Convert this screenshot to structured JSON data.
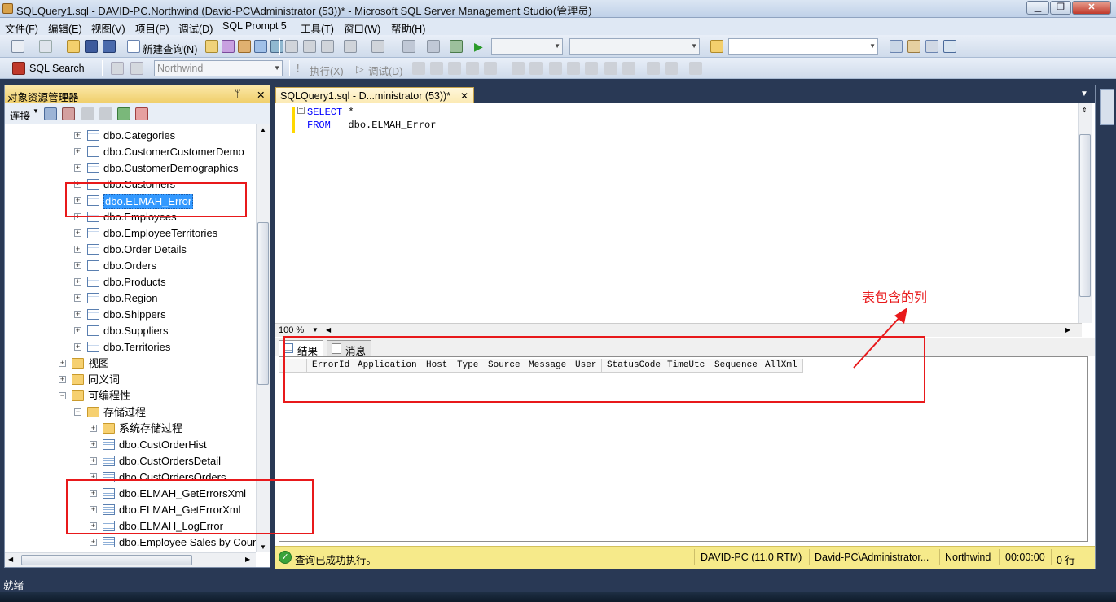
{
  "window": {
    "title": "SQLQuery1.sql - DAVID-PC.Northwind (David-PC\\Administrator (53))* - Microsoft SQL Server Management Studio(管理员)",
    "buttons": [
      "▁",
      "❐",
      "✕"
    ]
  },
  "menu": [
    "文件(F)",
    "编辑(E)",
    "视图(V)",
    "项目(P)",
    "调试(D)",
    "SQL Prompt 5",
    "工具(T)",
    "窗口(W)",
    "帮助(H)"
  ],
  "toolbar1": {
    "new_query": "新建查询(N)"
  },
  "toolbar2": {
    "sql_search": "SQL Search",
    "database": "Northwind",
    "execute": "执行(X)",
    "debug": "调试(D)"
  },
  "object_explorer": {
    "title": "对象资源管理器",
    "connect": "连接",
    "pin": "ᛘ",
    "close": "✕",
    "tree": [
      {
        "label": "dbo.Categories",
        "icon": "table-icon"
      },
      {
        "label": "dbo.CustomerCustomerDemo",
        "icon": "table-icon"
      },
      {
        "label": "dbo.CustomerDemographics",
        "icon": "table-icon"
      },
      {
        "label": "dbo.Customers",
        "icon": "table-icon"
      },
      {
        "label": "dbo.ELMAH_Error",
        "icon": "table-icon",
        "selected": true
      },
      {
        "label": "dbo.Employees",
        "icon": "table-icon"
      },
      {
        "label": "dbo.EmployeeTerritories",
        "icon": "table-icon"
      },
      {
        "label": "dbo.Order Details",
        "icon": "table-icon"
      },
      {
        "label": "dbo.Orders",
        "icon": "table-icon"
      },
      {
        "label": "dbo.Products",
        "icon": "table-icon"
      },
      {
        "label": "dbo.Region",
        "icon": "table-icon"
      },
      {
        "label": "dbo.Shippers",
        "icon": "table-icon"
      },
      {
        "label": "dbo.Suppliers",
        "icon": "table-icon"
      },
      {
        "label": "dbo.Territories",
        "icon": "table-icon"
      },
      {
        "label": "视图",
        "icon": "folder-icon"
      },
      {
        "label": "同义词",
        "icon": "folder-icon"
      },
      {
        "label": "可编程性",
        "icon": "folder-icon",
        "expanded": true
      },
      {
        "label": "存储过程",
        "icon": "folder-icon",
        "expanded": true
      },
      {
        "label": "系统存储过程",
        "icon": "folder-icon"
      },
      {
        "label": "dbo.CustOrderHist",
        "icon": "stored-procedure-icon"
      },
      {
        "label": "dbo.CustOrdersDetail",
        "icon": "stored-procedure-icon"
      },
      {
        "label": "dbo.CustOrdersOrders",
        "icon": "stored-procedure-icon"
      },
      {
        "label": "dbo.ELMAH_GetErrorsXml",
        "icon": "stored-procedure-icon"
      },
      {
        "label": "dbo.ELMAH_GetErrorXml",
        "icon": "stored-procedure-icon"
      },
      {
        "label": "dbo.ELMAH_LogError",
        "icon": "stored-procedure-icon"
      },
      {
        "label": "dbo.Employee Sales by Country",
        "icon": "stored-procedure-icon"
      }
    ]
  },
  "document": {
    "tab_label": "SQLQuery1.sql - D...ministrator (53))*",
    "tab_close": "✕",
    "sql_lines": [
      {
        "keyword": "SELECT",
        "text": " *"
      },
      {
        "keyword": "FROM",
        "text": "   dbo.ELMAH_Error"
      }
    ],
    "zoom": "100 %",
    "result_tabs": [
      "结果",
      "消息"
    ],
    "columns": [
      "ErrorId",
      "Application",
      "Host",
      "Type",
      "Source",
      "Message",
      "User",
      "StatusCode",
      "TimeUtc",
      "Sequence",
      "AllXml"
    ]
  },
  "status": {
    "message": "查询已成功执行。",
    "server": "DAVID-PC (11.0 RTM)",
    "user": "David-PC\\Administrator...",
    "database": "Northwind",
    "elapsed": "00:00:00",
    "rows": "0 行"
  },
  "bottom_status": "就绪",
  "annotation": "表包含的列",
  "colors": {
    "annotation": "#e8191b",
    "selection": "#3399ff",
    "status_bar": "#f6ea8a",
    "chrome": "#293955"
  }
}
